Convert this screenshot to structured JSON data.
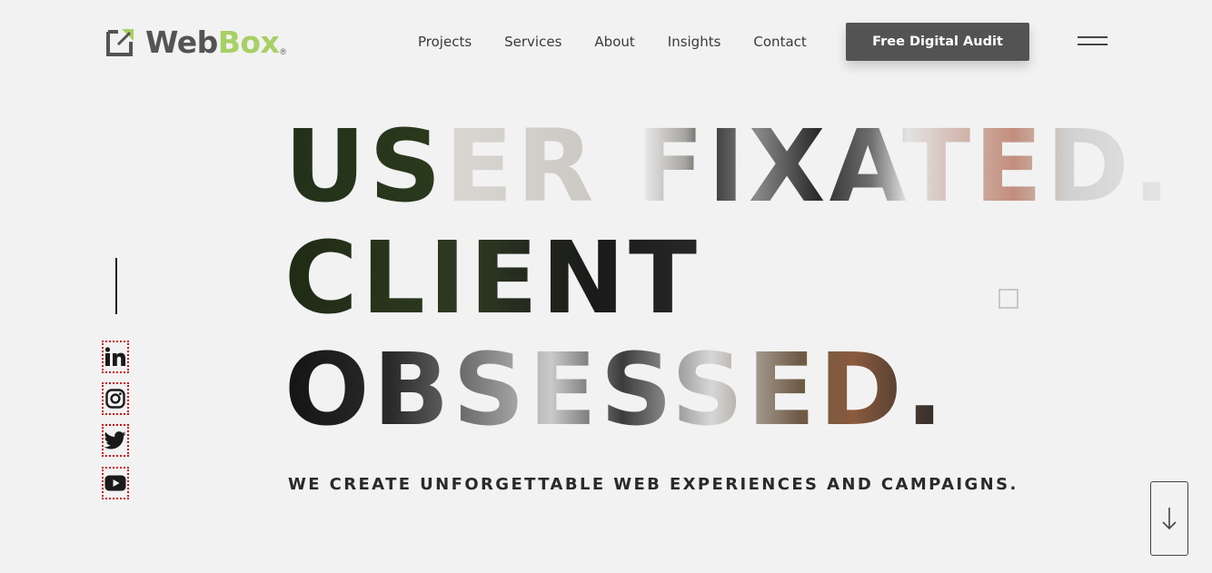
{
  "header": {
    "logo": {
      "word1": "Web",
      "word2": "Box",
      "mark": "®"
    },
    "nav": [
      {
        "label": "Projects"
      },
      {
        "label": "Services"
      },
      {
        "label": "About"
      },
      {
        "label": "Insights"
      },
      {
        "label": "Contact"
      }
    ],
    "cta_label": "Free Digital Audit",
    "menu_icon": "hamburger-icon"
  },
  "social": [
    {
      "name": "linkedin",
      "icon": "linkedin-icon"
    },
    {
      "name": "instagram",
      "icon": "instagram-icon"
    },
    {
      "name": "twitter",
      "icon": "twitter-icon"
    },
    {
      "name": "youtube",
      "icon": "youtube-icon"
    }
  ],
  "hero": {
    "lines": [
      "USER FIXATED.",
      "CLIENT",
      "OBSESSED."
    ],
    "tagline": "WE CREATE UNFORGETTABLE WEB EXPERIENCES AND CAMPAIGNS."
  },
  "scroll_icon": "arrow-down-icon",
  "colors": {
    "brand_green": "#a7d064",
    "brand_gray": "#545454",
    "cta_bg": "#535353",
    "page_bg": "#f2f2f2",
    "accent_dot": "#c98a74"
  }
}
